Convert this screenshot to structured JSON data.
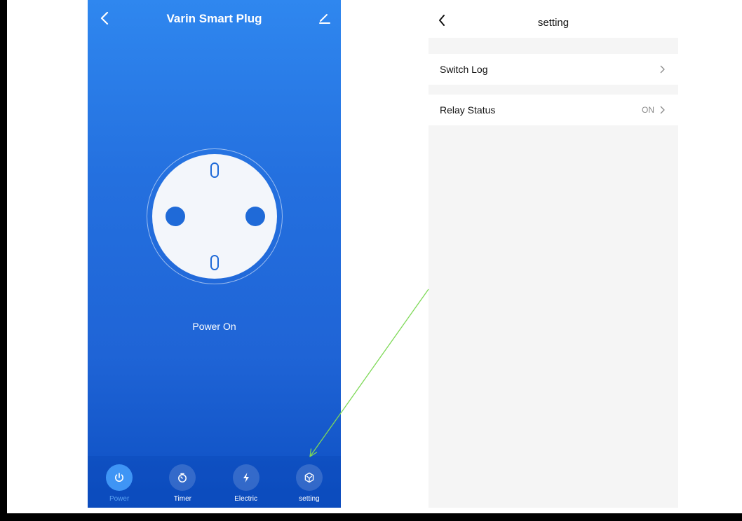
{
  "left_screen": {
    "title": "Varin Smart Plug",
    "status_text": "Power On",
    "tabs": [
      {
        "label": "Power",
        "icon": "power-icon",
        "active": true
      },
      {
        "label": "Timer",
        "icon": "timer-icon",
        "active": false
      },
      {
        "label": "Electric",
        "icon": "lightning-icon",
        "active": false
      },
      {
        "label": "setting",
        "icon": "settings-hex-icon",
        "active": false
      }
    ]
  },
  "right_screen": {
    "title": "setting",
    "rows": [
      {
        "label": "Switch Log",
        "value": ""
      },
      {
        "label": "Relay Status",
        "value": "ON"
      }
    ]
  },
  "colors": {
    "primary_blue": "#2470df",
    "active_tab": "#3f95f5",
    "annotation_arrow": "#7ed957"
  }
}
